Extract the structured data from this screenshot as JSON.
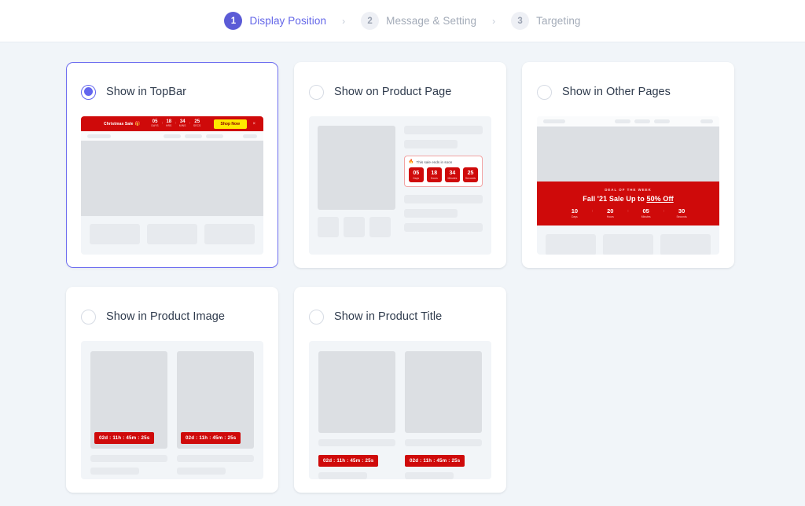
{
  "stepper": {
    "separator": "›",
    "steps": [
      {
        "num": "1",
        "label": "Display Position",
        "state": "active"
      },
      {
        "num": "2",
        "label": "Message & Setting",
        "state": "idle"
      },
      {
        "num": "3",
        "label": "Targeting",
        "state": "idle"
      }
    ]
  },
  "colors": {
    "accent": "#6366ee",
    "promo_red": "#cf0a0a",
    "promo_yellow": "#ffe800",
    "page_bg": "#f1f5f9",
    "card_bg": "#ffffff"
  },
  "cards": [
    {
      "id": "topbar",
      "title": "Show in TopBar",
      "selected": true,
      "preview": {
        "sale_text": "Christmas Sale",
        "gift_icon": "gift-icon",
        "countdown": [
          {
            "value": "05",
            "label": "DAYS"
          },
          {
            "value": "18",
            "label": "HRS"
          },
          {
            "value": "34",
            "label": "MINS"
          },
          {
            "value": "25",
            "label": "SECS"
          }
        ],
        "colon": ":",
        "cta": "Shop Now",
        "close_icon": "×"
      }
    },
    {
      "id": "product-page",
      "title": "Show on Product Page",
      "selected": false,
      "preview": {
        "notice": "This sale ends in soon",
        "flame_icon": "flame-icon",
        "countdown": [
          {
            "value": "05",
            "label": "Days"
          },
          {
            "value": "18",
            "label": "Hours"
          },
          {
            "value": "34",
            "label": "Minutes"
          },
          {
            "value": "25",
            "label": "Seconds"
          }
        ]
      }
    },
    {
      "id": "other-pages",
      "title": "Show in Other Pages",
      "selected": false,
      "preview": {
        "kicker": "DEAL OF THE WEEK",
        "headline_prefix": "Fall '21 Sale Up to ",
        "headline_underline": "50% Off",
        "colon": ":",
        "countdown": [
          {
            "value": "10",
            "label": "Days"
          },
          {
            "value": "20",
            "label": "Hours"
          },
          {
            "value": "05",
            "label": "Minutes"
          },
          {
            "value": "30",
            "label": "Seconds"
          }
        ]
      }
    },
    {
      "id": "product-image",
      "title": "Show in Product Image",
      "selected": false,
      "preview": {
        "badge": "02d : 11h : 45m : 25s"
      }
    },
    {
      "id": "product-title",
      "title": "Show in Product Title",
      "selected": false,
      "preview": {
        "badge": "02d : 11h : 45m : 25s"
      }
    }
  ]
}
